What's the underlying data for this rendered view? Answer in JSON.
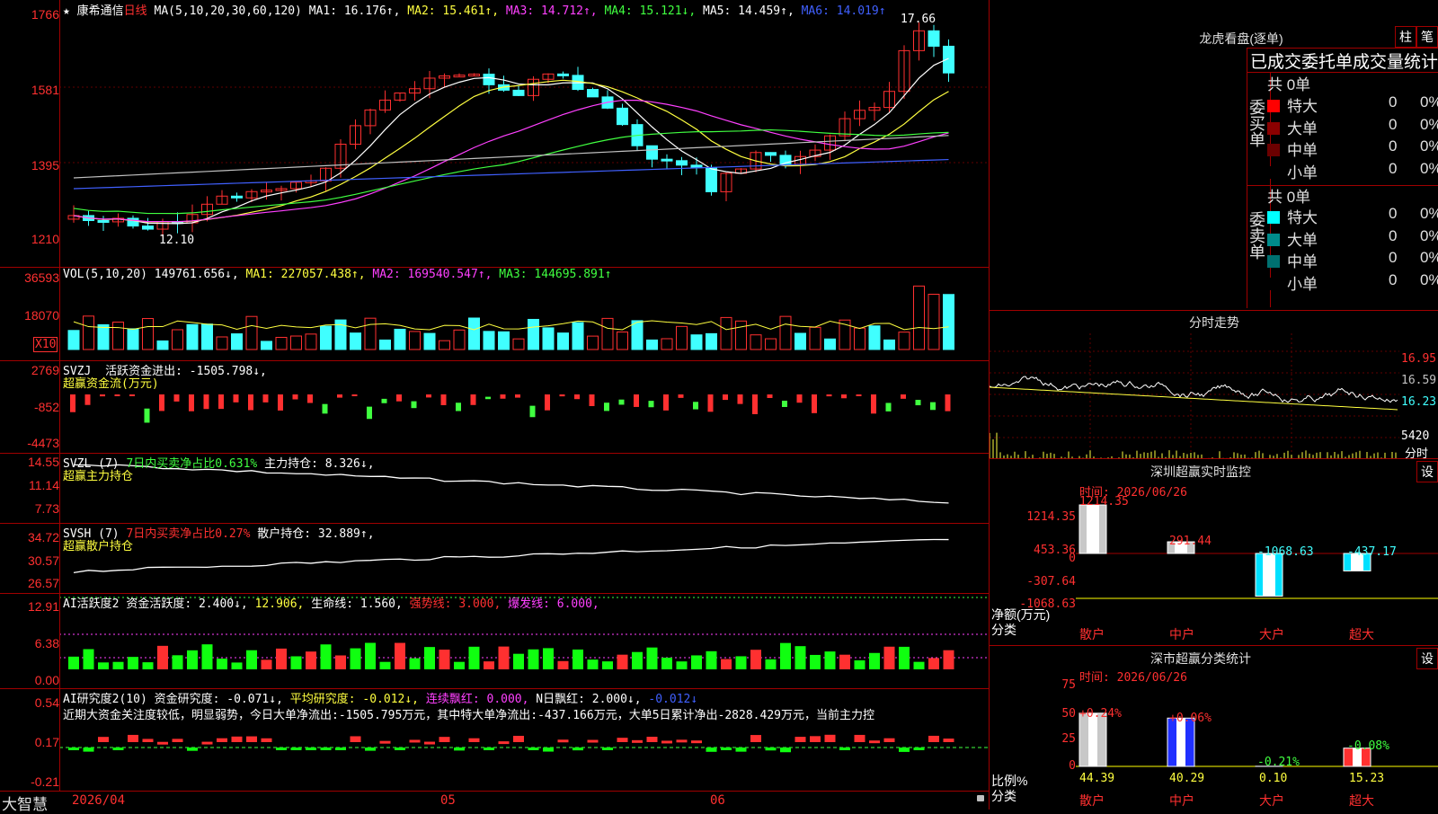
{
  "colors": {
    "up": "#ff3030",
    "down": "#40ffff",
    "grid": "#a00000",
    "ma1": "#ffffff",
    "ma2": "#ffff40",
    "ma3": "#ff40ff",
    "ma4": "#40ff40",
    "ma5": "#c0c0c0",
    "ma6": "#4060ff"
  },
  "main": {
    "star_icon": "★",
    "stock_name": "康希通信",
    "period": "日线",
    "ma_label": "MA(5,10,20,30,60,120)",
    "ma1": "MA1: 16.176↑,",
    "ma2": "MA2: 15.461↑,",
    "ma3": "MA3: 14.712↑,",
    "ma4": "MA4: 15.121↓,",
    "ma5": "MA5: 14.459↑,",
    "ma6": "MA6: 14.019↑",
    "axis": [
      "1766",
      "1581",
      "1395",
      "1210"
    ],
    "high_mark": "17.66",
    "low_mark": "12.10"
  },
  "vol": {
    "label": "VOL(5,10,20)",
    "value": "149761.656↓,",
    "ma1": "MA1: 227057.438↑,",
    "ma2": "MA2: 169540.547↑,",
    "ma3": "MA3: 144695.891↑",
    "axis": [
      "36593",
      "18070"
    ],
    "unit": "X10"
  },
  "svzj": {
    "title": "SVZJ",
    "item": "活跃资金进出: -1505.798↓,",
    "sub": "超赢资金流(万元)",
    "axis": [
      "2769",
      "-852",
      "-4473"
    ]
  },
  "svzl": {
    "title": "SVZL (7)",
    "ratio": "7日内买卖净占比0.631%",
    "hold": "主力持仓: 8.326↓,",
    "sub": "超赢主力持仓",
    "axis": [
      "14.55",
      "11.14",
      "7.73"
    ]
  },
  "svsh": {
    "title": "SVSH (7)",
    "ratio": "7日内买卖净占比0.27%",
    "hold": "散户持仓: 32.889↑,",
    "sub": "超赢散户持仓",
    "axis": [
      "34.72",
      "30.57",
      "26.57"
    ]
  },
  "ai1": {
    "title": "AI活跃度2",
    "a": "资金活跃度: 2.400↓,",
    "b": "12.906,",
    "c": "生命线: 1.560,",
    "d": "强势线: 3.000,",
    "e": "爆发线: 6.000,",
    "axis": [
      "12.91",
      "6.38",
      "0.00"
    ]
  },
  "ai2": {
    "title": "AI研究度2(10)",
    "a": "资金研究度: -0.071↓,",
    "b": "平均研究度: -0.012↓,",
    "c": "连续飘红: 0.000,",
    "d": "N日飘红: 2.000↓,",
    "e": "-0.012↓",
    "text": "近期大资金关注度较低，明显弱势，今日大单净流出:-1505.795万元，其中特大单净流出:-437.166万元，大单5日累计净出-2828.429万元，当前主力控",
    "axis": [
      "0.54",
      "0.17",
      "-0.21"
    ]
  },
  "bottom": {
    "brand": "大智慧",
    "date": "2026/04",
    "m05": "05",
    "m06": "06"
  },
  "lhb": {
    "title": "龙虎看盘(逐单)",
    "btn1": "柱",
    "btn2": "笔",
    "subtitle": "已成交委托单成交量统计",
    "buy_label": "委买单",
    "sell_label": "委卖单",
    "buy_total": "共 0单",
    "sell_total": "共 0单",
    "buy_rows": [
      {
        "name": "特大",
        "v": "0",
        "p": "0%"
      },
      {
        "name": "大单",
        "v": "0",
        "p": "0%"
      },
      {
        "name": "中单",
        "v": "0",
        "p": "0%"
      },
      {
        "name": "小单",
        "v": "0",
        "p": "0%"
      }
    ],
    "sell_rows": [
      {
        "name": "特大",
        "v": "0",
        "p": "0%"
      },
      {
        "name": "大单",
        "v": "0",
        "p": "0%"
      },
      {
        "name": "中单",
        "v": "0",
        "p": "0%"
      },
      {
        "name": "小单",
        "v": "0",
        "p": "0%"
      }
    ]
  },
  "fenshi": {
    "title": "分时走势",
    "axis": [
      "16.95",
      "16.59",
      "16.23"
    ],
    "vol": "5420",
    "tag": "分时"
  },
  "sz1": {
    "title": "深圳超赢实时监控",
    "btn": "设",
    "time": "时间: 2026/06/26",
    "axis": [
      "1214.35",
      "453.36",
      "0",
      "-307.64",
      "-1068.63"
    ],
    "ylabel": "净额(万元)",
    "xlabel": "分类",
    "cats": [
      "散户",
      "中户",
      "大户",
      "超大"
    ],
    "vals": [
      "1214.35",
      "291.44",
      "-1068.63",
      "-437.17"
    ]
  },
  "sz2": {
    "title": "深市超赢分类统计",
    "btn": "设",
    "time": "时间: 2026/06/26",
    "axis": [
      "75",
      "50",
      "25",
      "0"
    ],
    "ylabel": "比例%",
    "xlabel": "分类",
    "cats": [
      "散户",
      "中户",
      "大户",
      "超大"
    ],
    "pcts": [
      "+0.24%",
      "+0.06%",
      "-0.21%",
      "-0.08%"
    ],
    "vals": [
      "44.39",
      "40.29",
      "0.10",
      "15.23"
    ]
  }
}
